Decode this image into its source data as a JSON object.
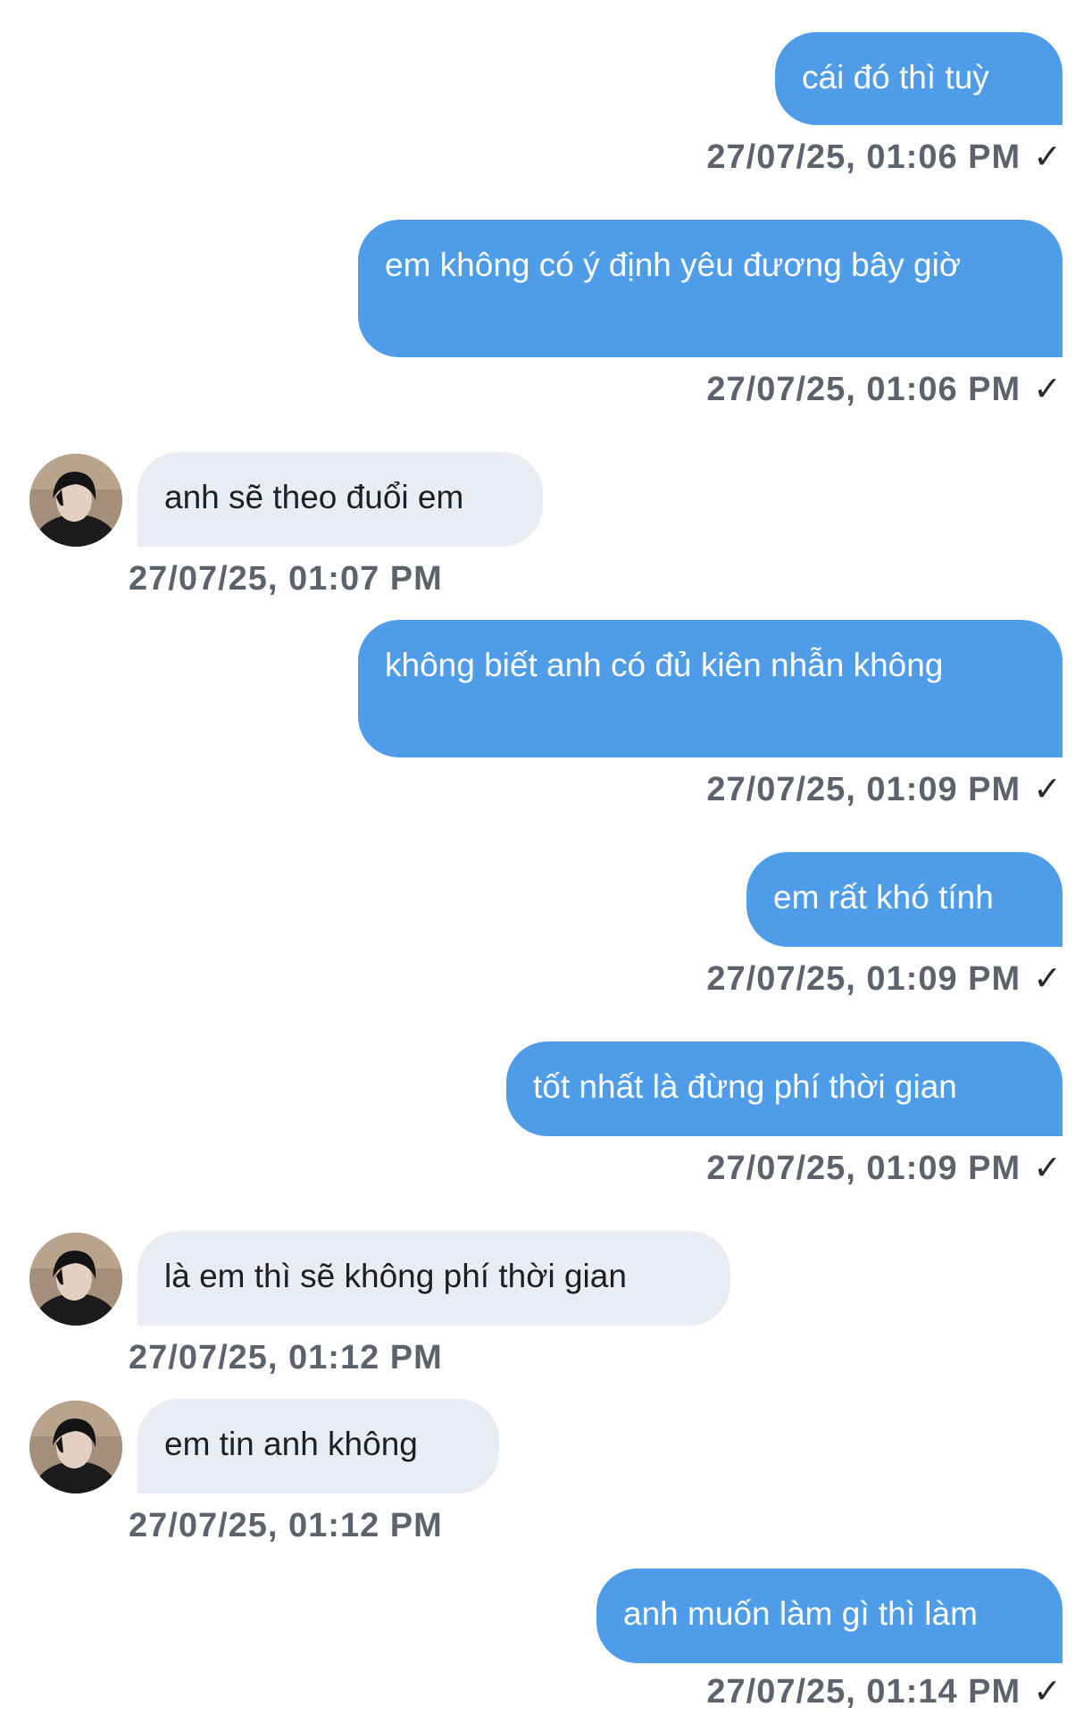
{
  "messages": [
    {
      "side": "out",
      "text": "cái đó thì tuỳ",
      "time": "27/07/25, 01:06 PM",
      "check": "✓"
    },
    {
      "side": "out",
      "text": "em không có ý định yêu đương bây giờ",
      "time": "27/07/25, 01:06 PM",
      "check": "✓"
    },
    {
      "side": "in",
      "text": "anh sẽ theo đuổi em",
      "time": "27/07/25, 01:07 PM"
    },
    {
      "side": "out",
      "text": "không biết anh có đủ kiên nhẫn không",
      "time": "27/07/25, 01:09 PM",
      "check": "✓"
    },
    {
      "side": "out",
      "text": "em rất khó tính",
      "time": "27/07/25, 01:09 PM",
      "check": "✓"
    },
    {
      "side": "out",
      "text": "tốt nhất là đừng phí thời gian",
      "time": "27/07/25, 01:09 PM",
      "check": "✓"
    },
    {
      "side": "in",
      "text": "là em thì sẽ không phí thời gian",
      "time": "27/07/25, 01:12 PM"
    },
    {
      "side": "in",
      "text": "em tin anh không",
      "time": "27/07/25, 01:12 PM"
    },
    {
      "side": "out",
      "text": "anh muốn làm gì thì làm",
      "time": "27/07/25, 01:14 PM",
      "check": "✓"
    }
  ],
  "colors": {
    "outgoing_bubble": "#4f9ce9",
    "incoming_bubble": "#e9ecf2",
    "timestamp": "#5d636d"
  },
  "icons": {
    "avatar": "contact-avatar-photo",
    "read_receipt": "check-icon"
  }
}
